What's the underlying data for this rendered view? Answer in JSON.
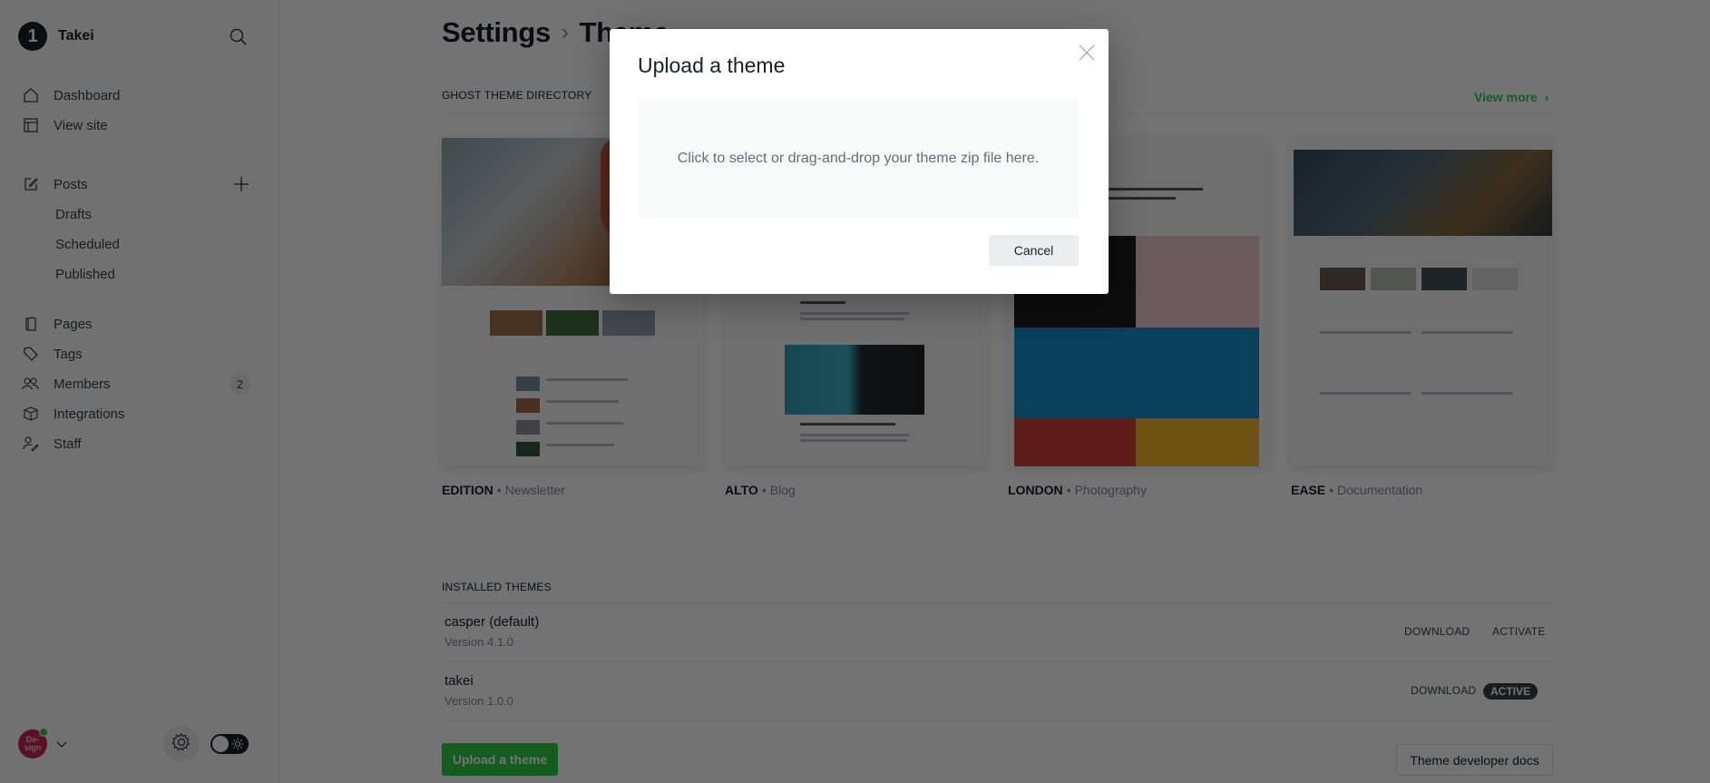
{
  "sidebar": {
    "brand": {
      "logo_text": "1",
      "name": "Takei"
    },
    "nav": [
      {
        "id": "dashboard",
        "label": "Dashboard",
        "icon": "home-icon"
      },
      {
        "id": "view-site",
        "label": "View site",
        "icon": "layout-icon"
      },
      {
        "id": "posts",
        "label": "Posts",
        "icon": "pencil-square-icon"
      },
      {
        "id": "pages",
        "label": "Pages",
        "icon": "page-icon"
      },
      {
        "id": "tags",
        "label": "Tags",
        "icon": "tag-icon"
      },
      {
        "id": "members",
        "label": "Members",
        "icon": "members-icon",
        "badge": "2"
      },
      {
        "id": "integrations",
        "label": "Integrations",
        "icon": "cube-icon"
      },
      {
        "id": "staff",
        "label": "Staff",
        "icon": "staff-icon"
      }
    ],
    "post_sub": [
      {
        "label": "Drafts"
      },
      {
        "label": "Scheduled"
      },
      {
        "label": "Published"
      }
    ],
    "account": {
      "avatar_text": "De-sign",
      "avatar_line1": "De-",
      "avatar_line2": "sign"
    }
  },
  "main": {
    "breadcrumb": {
      "parent": "Settings",
      "separator": "›",
      "current": "Theme"
    },
    "directory": {
      "label": "GHOST THEME DIRECTORY",
      "view_more": "View more",
      "themes": [
        {
          "name": "EDITION",
          "category": "Newsletter"
        },
        {
          "name": "ALTO",
          "category": "Blog"
        },
        {
          "name": "LONDON",
          "category": "Photography"
        },
        {
          "name": "EASE",
          "category": "Documentation"
        }
      ]
    },
    "installed": {
      "label": "INSTALLED THEMES",
      "themes": [
        {
          "name": "casper (default)",
          "version": "Version 4.1.0",
          "download": "DOWNLOAD",
          "action": "ACTIVATE",
          "active": false
        },
        {
          "name": "takei",
          "version": "Version 1.0.0",
          "download": "DOWNLOAD",
          "action": "ACTIVE",
          "active": true
        }
      ]
    },
    "upload_button": "Upload a theme",
    "docs_button": "Theme developer docs"
  },
  "modal": {
    "title": "Upload a theme",
    "dropzone_text": "Click to select or drag-and-drop your theme zip file here.",
    "cancel": "Cancel"
  },
  "colors": {
    "accent_green": "#30cf43",
    "text_dark": "#15212a",
    "muted": "#7c8b9a",
    "avatar": "#c72758"
  }
}
